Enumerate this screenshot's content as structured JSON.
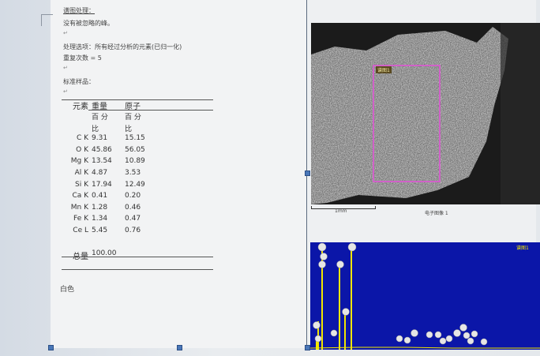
{
  "doc": {
    "heading_label": "谱图处理：",
    "peaks_text": "没有被忽略的峰。",
    "options_text": "处理选项：所有经过分析的元素(已归一化)",
    "iterations_text": "重复次数 = 5",
    "standard_label": "标准样品：",
    "color_note": "白色"
  },
  "table": {
    "header_element": "元素",
    "header_weight": "重量",
    "header_atomic": "原子",
    "sub_weight": [
      "百 分",
      "比"
    ],
    "sub_atomic": [
      "百 分",
      "比"
    ],
    "rows": [
      {
        "el": "C K",
        "w": "9.31",
        "a": "15.15"
      },
      {
        "el": "O K",
        "w": "45.86",
        "a": "56.05"
      },
      {
        "el": "Mg K",
        "w": "13.54",
        "a": "10.89"
      },
      {
        "el": "Al K",
        "w": "4.87",
        "a": "3.53"
      },
      {
        "el": "Si K",
        "w": "17.94",
        "a": "12.49"
      },
      {
        "el": "Ca K",
        "w": "0.41",
        "a": "0.20"
      },
      {
        "el": "Mn K",
        "w": "1.28",
        "a": "0.46"
      },
      {
        "el": "Fe K",
        "w": "1.34",
        "a": "0.47"
      },
      {
        "el": "Ce L",
        "w": "5.45",
        "a": "0.76"
      }
    ],
    "total_label": "总量",
    "total_value": "100.00"
  },
  "image": {
    "roi_label": "谱图1",
    "scale_label": "1mm",
    "caption": "电子图像 1"
  },
  "spectrum": {
    "label": "谱图1",
    "bg_color": "#0b16a8",
    "line_color": "#f2e600"
  },
  "colors": {
    "roi": "#d062c8",
    "page": "#f2f3f4"
  }
}
